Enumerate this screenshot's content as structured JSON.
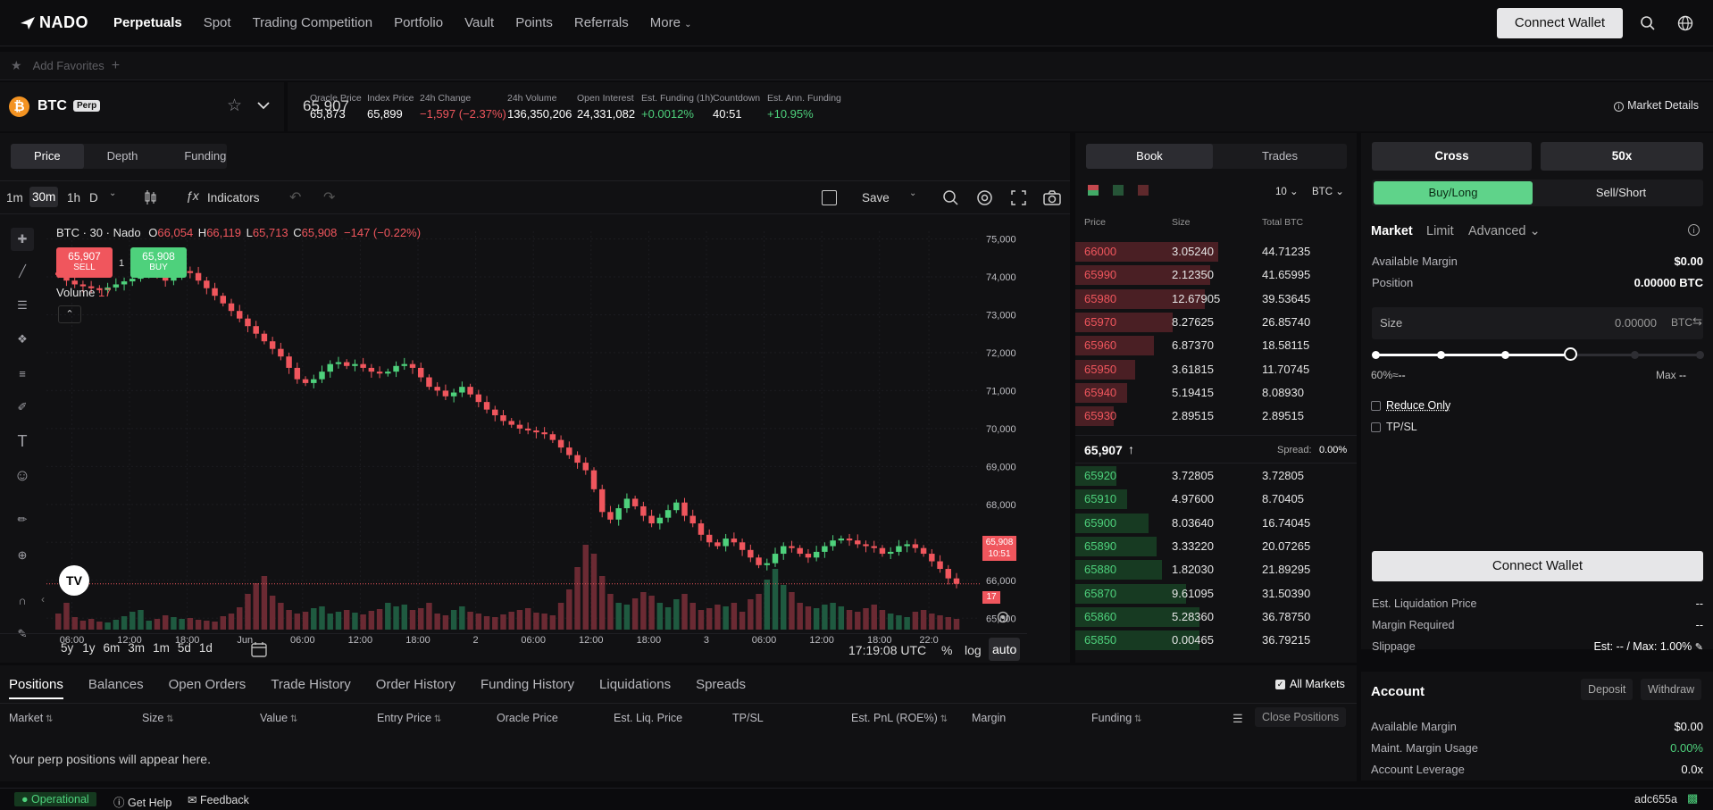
{
  "nav": {
    "logo": "NADO",
    "items": [
      "Perpetuals",
      "Spot",
      "Trading Competition",
      "Portfolio",
      "Vault",
      "Points",
      "Referrals",
      "More"
    ],
    "connect_wallet": "Connect Wallet"
  },
  "favorites": {
    "label": "Add Favorites"
  },
  "market": {
    "symbol": "BTC",
    "badge": "Perp",
    "price": "65,907",
    "stats": [
      {
        "key": "Oracle Price",
        "value": "65,873",
        "color": "#ffffff"
      },
      {
        "key": "Index Price",
        "value": "65,899",
        "color": "#ffffff"
      },
      {
        "key": "24h Change",
        "value": "−1,597 (−2.37%)",
        "color": "#f0565d"
      },
      {
        "key": "24h Volume",
        "value": "136,350,206",
        "color": "#ffffff"
      },
      {
        "key": "Open Interest",
        "value": "24,331,082",
        "color": "#ffffff"
      },
      {
        "key": "Est. Funding (1h)",
        "value": "+0.0012%",
        "color": "#4ed17c"
      },
      {
        "key": "Countdown",
        "value": "40:51",
        "color": "#ffffff"
      },
      {
        "key": "Est. Ann. Funding",
        "value": "+10.95%",
        "color": "#4ed17c"
      }
    ],
    "details": "Market Details"
  },
  "chart_tabs": [
    "Price",
    "Depth",
    "Funding"
  ],
  "chart_toolbar": {
    "intervals": [
      "1m",
      "30m",
      "1h",
      "D"
    ],
    "indicators": "Indicators",
    "save": "Save"
  },
  "chart_legend": {
    "title": "BTC · 30 · Nado",
    "o_label": "O",
    "o": "66,054",
    "h_label": "H",
    "h": "66,119",
    "l_label": "L",
    "l": "65,713",
    "c_label": "C",
    "c": "65,908",
    "chg": "−147 (−0.22%)",
    "sell_price": "65,907",
    "sell": "SELL",
    "qty": "1",
    "buy_price": "65,908",
    "buy": "BUY",
    "volume_label": "Volume",
    "volume": "17",
    "last_price": "65,908",
    "countdown": "10:51",
    "vol_tag": "17"
  },
  "chart_data": {
    "type": "candlestick",
    "y_ticks": [
      "75,000",
      "74,000",
      "73,000",
      "72,000",
      "71,000",
      "70,000",
      "69,000",
      "68,000",
      "67,000",
      "66,000",
      "65,000"
    ],
    "x_ticks": [
      "06:00",
      "12:00",
      "18:00",
      "Jun",
      "06:00",
      "12:00",
      "18:00",
      "2",
      "06:00",
      "12:00",
      "18:00",
      "3",
      "06:00",
      "12:00",
      "18:00",
      "22:0"
    ],
    "ylim": [
      64700,
      75200
    ],
    "close": [
      74050,
      73900,
      73800,
      73750,
      73700,
      73650,
      73720,
      73800,
      73880,
      73950,
      74100,
      74200,
      74050,
      73900,
      74000,
      74150,
      74100,
      73900,
      73700,
      73500,
      73300,
      73100,
      72900,
      72700,
      72500,
      72300,
      72100,
      71900,
      71600,
      71300,
      71200,
      71300,
      71500,
      71700,
      71750,
      71650,
      71700,
      71600,
      71500,
      71450,
      71500,
      71650,
      71700,
      71600,
      71350,
      71100,
      71000,
      70850,
      70950,
      71100,
      70900,
      70700,
      70500,
      70350,
      70200,
      70100,
      70000,
      69950,
      69900,
      69850,
      69700,
      69500,
      69300,
      69100,
      68900,
      68400,
      67800,
      67600,
      67900,
      68150,
      67950,
      67700,
      67500,
      67650,
      67850,
      68050,
      67700,
      67500,
      67200,
      67000,
      66900,
      67100,
      67000,
      66800,
      66600,
      66400,
      66450,
      66700,
      66900,
      66850,
      66700,
      66600,
      66750,
      66900,
      67050,
      67100,
      67050,
      66950,
      66900,
      66850,
      66700,
      66750,
      66900,
      66950,
      66850,
      66700,
      66500,
      66300,
      66050,
      65908
    ],
    "volume": [
      18,
      30,
      14,
      10,
      12,
      9,
      8,
      11,
      15,
      20,
      22,
      10,
      12,
      16,
      14,
      12,
      13,
      11,
      10,
      9,
      15,
      18,
      25,
      40,
      52,
      60,
      38,
      30,
      22,
      18,
      20,
      24,
      26,
      18,
      20,
      22,
      19,
      17,
      21,
      23,
      30,
      26,
      28,
      22,
      24,
      30,
      18,
      16,
      22,
      26,
      20,
      18,
      15,
      14,
      17,
      20,
      22,
      24,
      19,
      18,
      16,
      30,
      45,
      70,
      95,
      85,
      60,
      40,
      30,
      28,
      35,
      42,
      38,
      30,
      25,
      34,
      40,
      30,
      22,
      24,
      28,
      26,
      30,
      20,
      34,
      40,
      56,
      68,
      50,
      42,
      30,
      26,
      24,
      28,
      30,
      26,
      22,
      20,
      24,
      28,
      22,
      18,
      16,
      14,
      20,
      22,
      18,
      16,
      14,
      12
    ]
  },
  "chart_bottom": {
    "ranges": [
      "5y",
      "1y",
      "6m",
      "3m",
      "1m",
      "5d",
      "1d"
    ],
    "time": "17:19:08 UTC",
    "pct": "%",
    "log": "log",
    "auto": "auto"
  },
  "orderbook": {
    "tabs": [
      "Book",
      "Trades"
    ],
    "depth": "10",
    "unit": "BTC",
    "headers": [
      "Price",
      "Size",
      "Total BTC"
    ],
    "asks": [
      {
        "price": "66000",
        "size": "3.05240",
        "total": "44.71235",
        "fill": 0.42
      },
      {
        "price": "65990",
        "size": "2.12350",
        "total": "41.65995",
        "fill": 0.39
      },
      {
        "price": "65980",
        "size": "12.67905",
        "total": "39.53645",
        "fill": 0.37
      },
      {
        "price": "65970",
        "size": "8.27625",
        "total": "26.85740",
        "fill": 0.25
      },
      {
        "price": "65960",
        "size": "6.87370",
        "total": "18.58115",
        "fill": 0.18
      },
      {
        "price": "65950",
        "size": "3.61815",
        "total": "11.70745",
        "fill": 0.11
      },
      {
        "price": "65940",
        "size": "5.19415",
        "total": "8.08930",
        "fill": 0.08
      },
      {
        "price": "65930",
        "size": "2.89515",
        "total": "2.89515",
        "fill": 0.03
      }
    ],
    "mid_price": "65,907",
    "spread_label": "Spread:",
    "spread": "0.00%",
    "bids": [
      {
        "price": "65920",
        "size": "3.72805",
        "total": "3.72805",
        "fill": 0.04
      },
      {
        "price": "65910",
        "size": "4.97600",
        "total": "8.70405",
        "fill": 0.08
      },
      {
        "price": "65900",
        "size": "8.03640",
        "total": "16.74045",
        "fill": 0.16
      },
      {
        "price": "65890",
        "size": "3.33220",
        "total": "20.07265",
        "fill": 0.19
      },
      {
        "price": "65880",
        "size": "1.82030",
        "total": "21.89295",
        "fill": 0.21
      },
      {
        "price": "65870",
        "size": "9.61095",
        "total": "31.50390",
        "fill": 0.3
      },
      {
        "price": "65860",
        "size": "5.28360",
        "total": "36.78750",
        "fill": 0.35
      },
      {
        "price": "65850",
        "size": "0.00465",
        "total": "36.79215",
        "fill": 0.35
      }
    ]
  },
  "trade": {
    "margin_mode": "Cross",
    "leverage": "50x",
    "buy": "Buy/Long",
    "sell": "Sell/Short",
    "order_types": [
      "Market",
      "Limit",
      "Advanced"
    ],
    "available_margin_label": "Available Margin",
    "available_margin": "$0.00",
    "position_label": "Position",
    "position": "0.00000 BTC",
    "size_label": "Size",
    "size_value": "0.00000",
    "size_unit": "BTC",
    "slider_fraction": 0.6,
    "slider_pct_label": "60%≈",
    "slider_pct_value": "--",
    "max_label": "Max",
    "max_value": "--",
    "reduce_only": "Reduce Only",
    "tpsl": "TP/SL",
    "connect_wallet": "Connect Wallet",
    "est_liq_label": "Est. Liquidation Price",
    "est_liq": "--",
    "margin_req_label": "Margin Required",
    "margin_req": "--",
    "slippage_label": "Slippage",
    "slippage": "Est: -- / Max: 1.00%"
  },
  "account": {
    "title": "Account",
    "deposit": "Deposit",
    "withdraw": "Withdraw",
    "available_margin_label": "Available Margin",
    "available_margin": "$0.00",
    "maint_label": "Maint. Margin Usage",
    "maint": "0.00%",
    "leverage_label": "Account Leverage",
    "leverage": "0.0x"
  },
  "positions": {
    "tabs": [
      "Positions",
      "Balances",
      "Open Orders",
      "Trade History",
      "Order History",
      "Funding History",
      "Liquidations",
      "Spreads"
    ],
    "all_markets": "All Markets",
    "columns": [
      "Market",
      "Size",
      "Value",
      "Entry Price",
      "Oracle Price",
      "Est. Liq. Price",
      "TP/SL",
      "Est. PnL (ROE%)",
      "Margin",
      "Funding"
    ],
    "close_positions": "Close Positions",
    "empty": "Your perp positions will appear here."
  },
  "status": {
    "operational": "Operational",
    "help": "Get Help",
    "feedback": "Feedback",
    "version": "adc655a"
  }
}
